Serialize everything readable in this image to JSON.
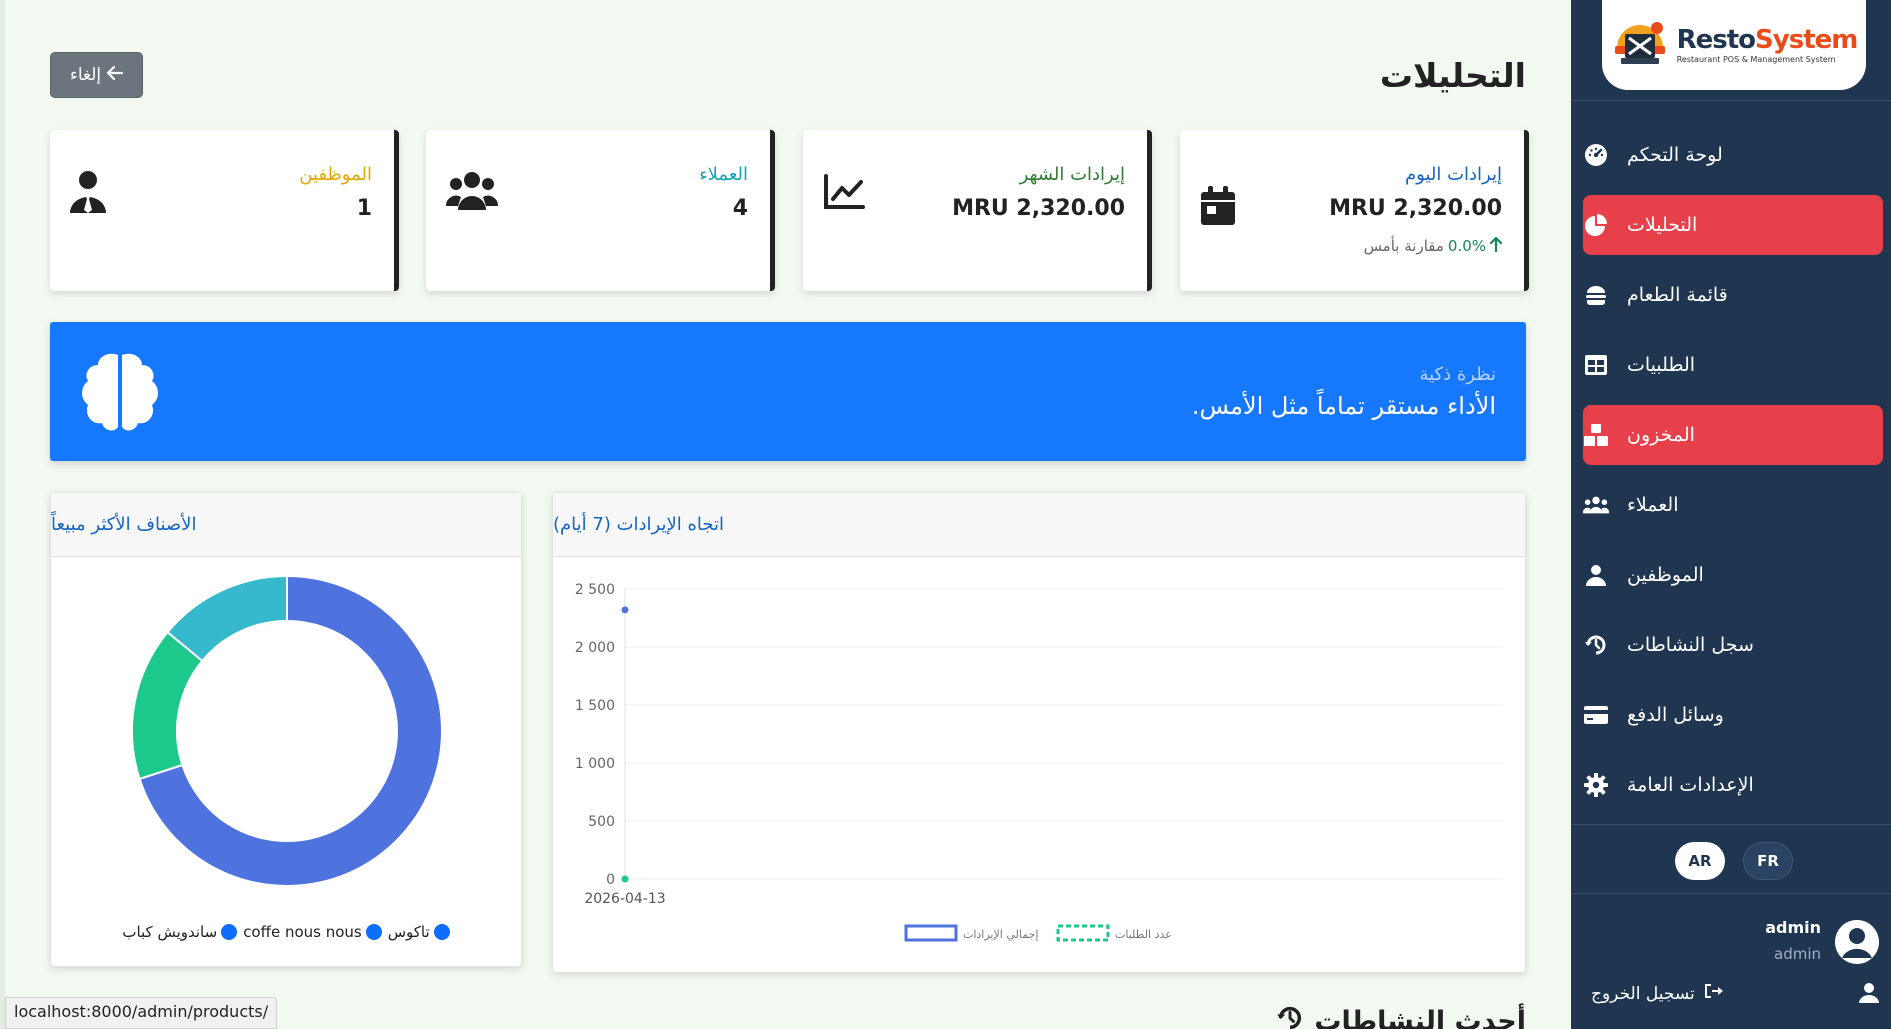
{
  "header": {
    "title": "التحليلات",
    "cancel_label": "إلغاء"
  },
  "sidebar": {
    "brand_resto": "Resto",
    "brand_system": "System",
    "brand_tagline": "Restaurant POS & Management System",
    "items": [
      {
        "label": "لوحة التحكم",
        "icon": "gauge-icon",
        "active": false
      },
      {
        "label": "التحليلات",
        "icon": "pie-chart-icon",
        "active": true
      },
      {
        "label": "قائمة الطعام",
        "icon": "burger-icon",
        "active": false
      },
      {
        "label": "الطلبيات",
        "icon": "table-icon",
        "active": false
      },
      {
        "label": "المخزون",
        "icon": "boxes-icon",
        "active": true
      },
      {
        "label": "العملاء",
        "icon": "users-icon",
        "active": false
      },
      {
        "label": "الموظفين",
        "icon": "user-icon",
        "active": false
      },
      {
        "label": "سجل النشاطات",
        "icon": "history-icon",
        "active": false
      },
      {
        "label": "وسائل الدفع",
        "icon": "credit-card-icon",
        "active": false
      },
      {
        "label": "الإعدادات العامة",
        "icon": "gear-icon",
        "active": false
      }
    ],
    "lang_ar": "AR",
    "lang_fr": "FR",
    "user_name": "admin",
    "user_role": "admin",
    "logout_label": "تسجيل الخروج"
  },
  "stats": {
    "today": {
      "label": "إيرادات اليوم",
      "value": "MRU 2,320.00",
      "change": "0.0%",
      "change_label": "مقارنة بأمس",
      "label_color": "#1565c0"
    },
    "month": {
      "label": "إيرادات الشهر",
      "value": "MRU 2,320.00",
      "label_color": "#2e7d32"
    },
    "customers": {
      "label": "العملاء",
      "value": "4",
      "label_color": "#17a2b8"
    },
    "employees": {
      "label": "الموظفين",
      "value": "1",
      "label_color": "#e0a800"
    }
  },
  "insight": {
    "label": "نظرة ذكية",
    "text": "الأداء مستقر تماماً مثل الأمس."
  },
  "panels": {
    "revenue_title": "اتجاه الإيرادات (7 أيام)",
    "top_items_title": "الأصناف الأكثر مبيعاً"
  },
  "status_url": "localhost:8000/admin/products/",
  "next_section": "أحدث النشاطات",
  "chart_data": [
    {
      "type": "line",
      "title": "اتجاه الإيرادات (7 أيام)",
      "x": [
        "2026-04-13"
      ],
      "series": [
        {
          "name": "إجمالي الإيرادات",
          "values": [
            2320
          ],
          "color": "#4e73df"
        },
        {
          "name": "عدد الطلبات",
          "values": [
            0
          ],
          "color": "#1cc88a"
        }
      ],
      "ylim": [
        0,
        2500
      ],
      "yticks": [
        "2 500",
        "2 000",
        "1 500",
        "1 000",
        "500",
        "0"
      ],
      "ytick_values": [
        2500,
        2000,
        1500,
        1000,
        500,
        0
      ],
      "grid": true,
      "legend": "bottom"
    },
    {
      "type": "pie",
      "title": "الأصناف الأكثر مبيعاً",
      "categories": [
        "تاكوس",
        "coffe nous nous",
        "ساندويش كباب"
      ],
      "values": [
        70,
        16,
        14
      ],
      "colors": [
        "#4e73df",
        "#1cc88a",
        "#36b9cc"
      ],
      "donut": true,
      "legend": "bottom"
    }
  ]
}
